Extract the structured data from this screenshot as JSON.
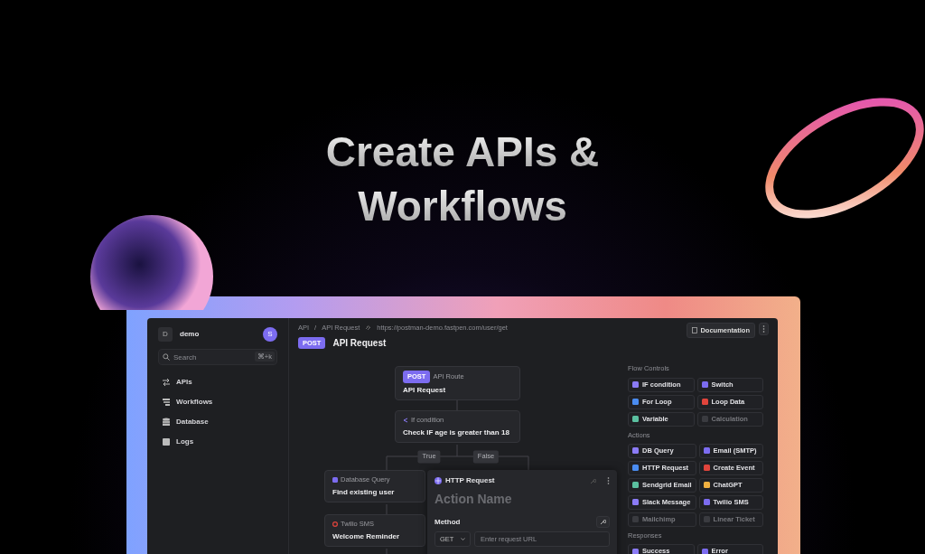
{
  "headline": [
    "Create APIs &",
    "Workflows"
  ],
  "workspace": {
    "initial": "D",
    "name": "demo",
    "avatar": "S"
  },
  "search": {
    "placeholder": "Search",
    "shortcut": "⌘+k"
  },
  "nav": [
    {
      "label": "APIs"
    },
    {
      "label": "Workflows"
    },
    {
      "label": "Database"
    },
    {
      "label": "Logs"
    }
  ],
  "breadcrumb": [
    "API",
    "API Request"
  ],
  "breadcrumb_separator": "/",
  "url": "https://postman-demo.fastpen.com/user/get",
  "header": {
    "method": "POST",
    "title": "API Request",
    "doc_button": "Documentation"
  },
  "flow": {
    "nodes": [
      {
        "kind": "route",
        "badge": "POST",
        "type": "API Route",
        "title": "API Request"
      },
      {
        "kind": "condition",
        "type": "If condition",
        "title": "Check IF age is greater than 18"
      },
      {
        "kind": "db",
        "type": "Database Query",
        "title": "Find existing user"
      },
      {
        "kind": "sms",
        "type": "Twilio SMS",
        "title": "Welcome Reminder"
      }
    ],
    "branches": [
      "True",
      "False"
    ]
  },
  "panel": {
    "type": "HTTP Request",
    "name_placeholder": "Action Name",
    "method_label": "Method",
    "method": "GET",
    "url_placeholder": "Enter request URL"
  },
  "palette": [
    {
      "heading": "Flow Controls",
      "items": [
        {
          "label": "IF condition",
          "disabled": false
        },
        {
          "label": "Switch",
          "disabled": false
        },
        {
          "label": "For Loop",
          "disabled": false
        },
        {
          "label": "Loop Data",
          "disabled": false
        },
        {
          "label": "Variable",
          "disabled": false
        },
        {
          "label": "Calculation",
          "disabled": true
        }
      ]
    },
    {
      "heading": "Actions",
      "items": [
        {
          "label": "DB Query",
          "disabled": false
        },
        {
          "label": "Email (SMTP)",
          "disabled": false
        },
        {
          "label": "HTTP Request",
          "disabled": false
        },
        {
          "label": "Create Event",
          "disabled": false
        },
        {
          "label": "Sendgrid Email",
          "disabled": false
        },
        {
          "label": "ChatGPT",
          "disabled": false
        },
        {
          "label": "Slack Message",
          "disabled": false
        },
        {
          "label": "Twilio SMS",
          "disabled": false
        },
        {
          "label": "Mailchimp",
          "disabled": true
        },
        {
          "label": "Linear Ticket",
          "disabled": true
        }
      ]
    },
    {
      "heading": "Responses",
      "items": [
        {
          "label": "Success",
          "disabled": false
        },
        {
          "label": "Error",
          "disabled": false
        }
      ]
    }
  ]
}
